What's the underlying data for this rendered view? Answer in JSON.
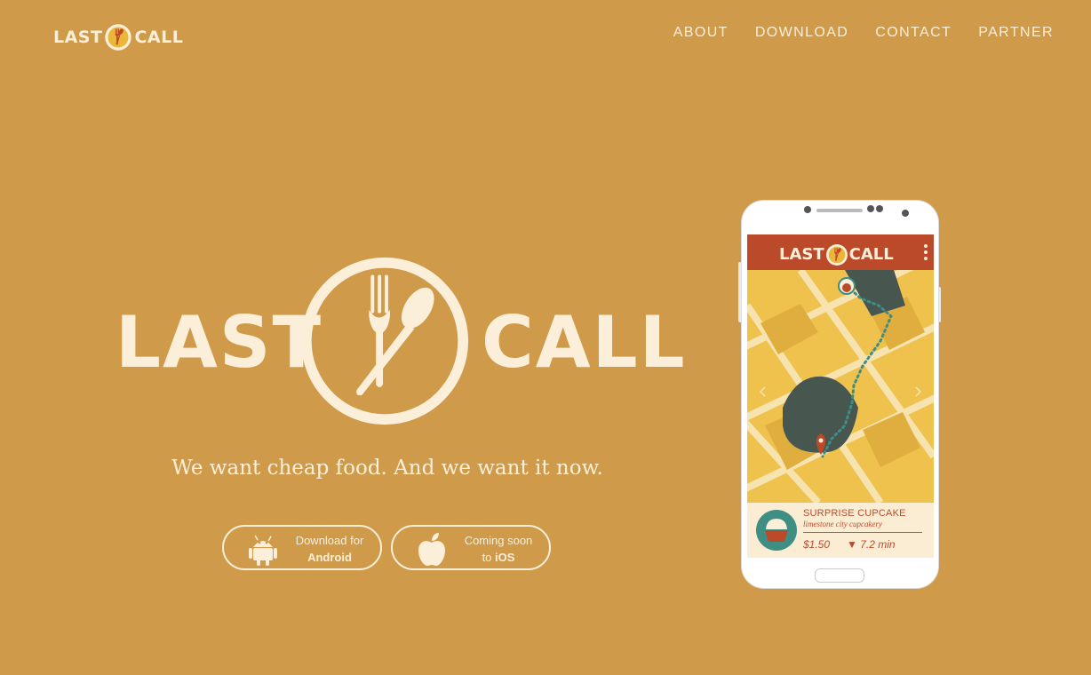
{
  "brand": {
    "word_left": "LAST",
    "word_right": "CALL",
    "emblem": "fork-spoon-emblem-icon"
  },
  "nav": {
    "items": [
      {
        "label": "ABOUT"
      },
      {
        "label": "DOWNLOAD"
      },
      {
        "label": "CONTACT"
      },
      {
        "label": "PARTNER"
      }
    ]
  },
  "hero": {
    "word_left": "LAST",
    "word_right": "CALL",
    "tagline": "We want cheap food. And we want it now."
  },
  "downloads": {
    "android": {
      "line1": "Download for",
      "line2": "Android",
      "icon": "android-icon"
    },
    "ios": {
      "line1": "Coming soon",
      "line2_prefix": "to ",
      "line2": "iOS",
      "icon": "apple-icon"
    }
  },
  "phone": {
    "app_name_left": "LAST",
    "app_name_right": "CALL",
    "deal": {
      "title": "SURPRISE CUPCAKE",
      "vendor": "limestone city cupcakery",
      "price": "$1.50",
      "time": "7.2 min"
    }
  },
  "colors": {
    "background": "#cf9a4a",
    "cream": "#fcefd9",
    "app_red": "#bb4a2b",
    "map_yellow": "#e7b84a",
    "map_dark": "#485650",
    "teal": "#3f8e84"
  }
}
